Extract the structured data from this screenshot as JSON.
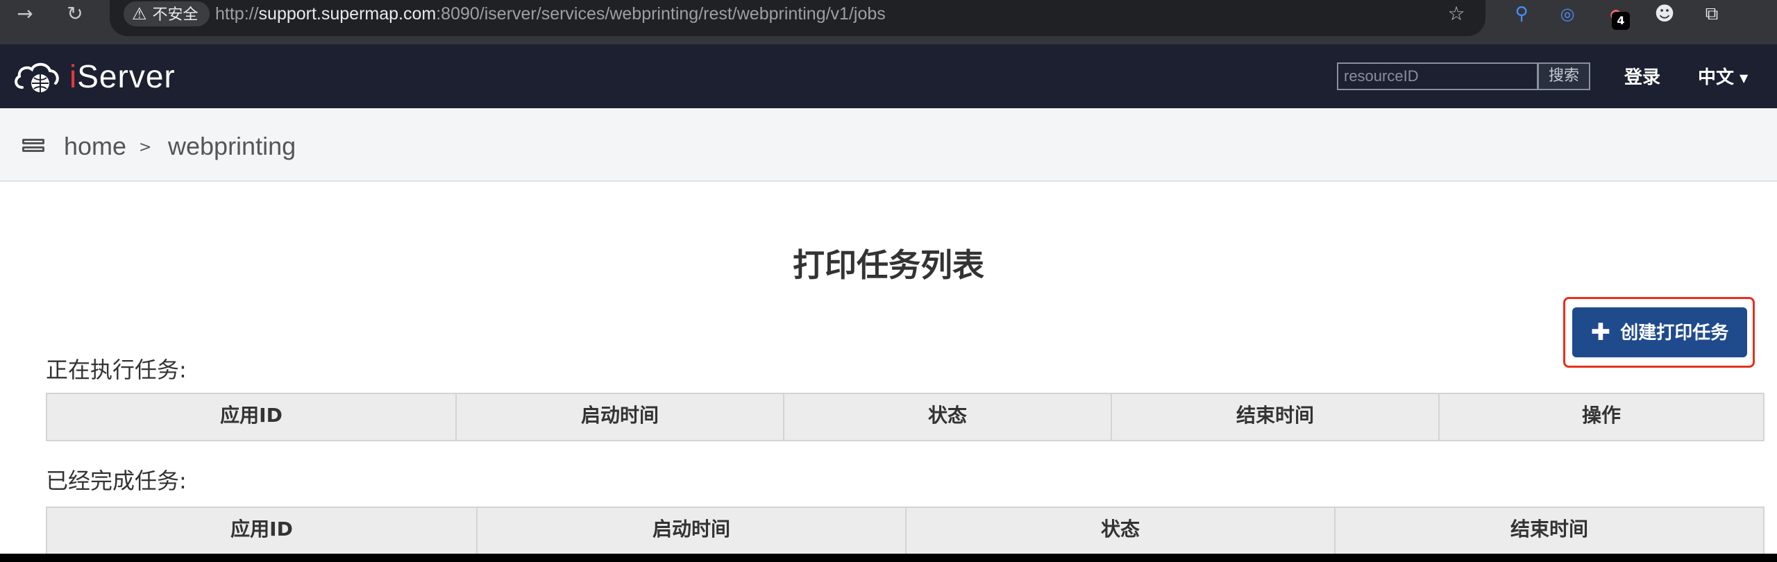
{
  "browser": {
    "security_label": "不安全",
    "url_prefix": "http://",
    "url_host": "support.supermap.com",
    "url_rest": ":8090/iserver/services/webprinting/rest/webprinting/v1/jobs",
    "extension_badge": "4"
  },
  "header": {
    "logo_prefix": "i",
    "logo_rest": "Server",
    "search_placeholder": "resourceID",
    "search_button": "搜索",
    "login": "登录",
    "language": "中文"
  },
  "breadcrumb": {
    "home": "home",
    "separator": ">",
    "current": "webprinting"
  },
  "main": {
    "title": "打印任务列表",
    "create_button": "创建打印任务",
    "running_label": "正在执行任务:",
    "running_columns": [
      "应用ID",
      "启动时间",
      "状态",
      "结束时间",
      "操作"
    ],
    "finished_label": "已经完成任务:",
    "finished_columns": [
      "应用ID",
      "启动时间",
      "状态",
      "结束时间"
    ]
  },
  "colors": {
    "header_bg": "#1c2030",
    "primary_button": "#1f4a8c",
    "highlight_border": "#e5311c"
  }
}
